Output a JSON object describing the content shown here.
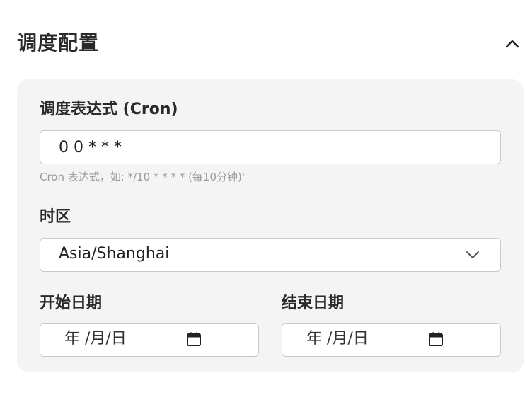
{
  "section": {
    "title": "调度配置",
    "toggle_icon": "chevron-up-icon"
  },
  "cron": {
    "label": "调度表达式 (Cron)",
    "value": "0 0 * * *",
    "hint": "Cron 表达式，如: */10 * * * * (每10分钟)'"
  },
  "timezone": {
    "label": "时区",
    "selected": "Asia/Shanghai",
    "chevron_icon": "chevron-down-icon"
  },
  "start_date": {
    "label": "开始日期",
    "placeholder": "年 /月/日",
    "icon": "calendar-icon"
  },
  "end_date": {
    "label": "结束日期",
    "placeholder": "年 /月/日",
    "icon": "calendar-icon"
  },
  "colors": {
    "panel_bg": "#f4f4f4",
    "border": "#c8c8c8",
    "hint": "#9a9a9a",
    "text": "#2a2a2a"
  }
}
